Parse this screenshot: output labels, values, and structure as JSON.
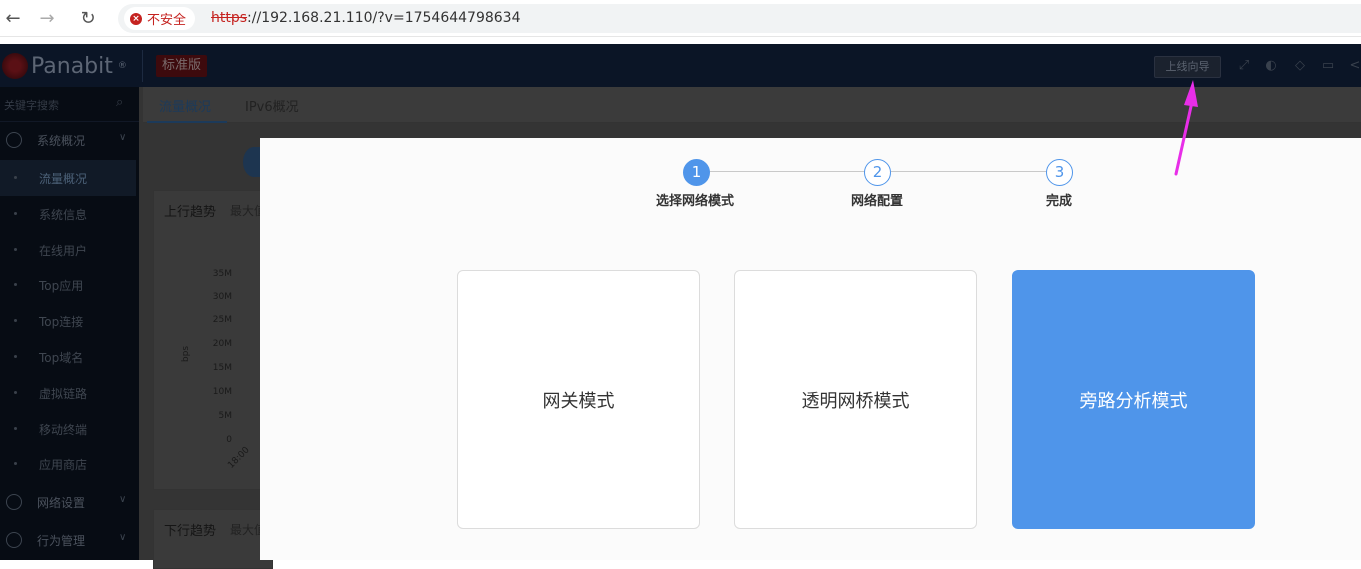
{
  "browser": {
    "back_icon": "arrow-left-icon",
    "forward_icon": "arrow-right-icon",
    "reload_icon": "reload-icon",
    "security_label": "不安全",
    "url_protocol": "https",
    "url_rest": "://192.168.21.110/?v=1754644798634"
  },
  "header": {
    "logo_text": "Panabit",
    "logo_mark": "®",
    "edition_badge": "标准版",
    "wizard_button": "上线向导",
    "icons": [
      "fullscreen-icon",
      "gamepad-icon",
      "bell-icon",
      "book-icon",
      "share-icon"
    ]
  },
  "sidebar": {
    "search_placeholder": "关键字搜索",
    "groups": [
      {
        "label": "系统概况",
        "icon": "dashboard-icon"
      },
      {
        "label": "网络设置",
        "icon": "network-icon"
      },
      {
        "label": "行为管理",
        "icon": "behavior-icon"
      }
    ],
    "items": [
      {
        "label": "流量概况",
        "active": true
      },
      {
        "label": "系统信息"
      },
      {
        "label": "在线用户"
      },
      {
        "label": "Top应用"
      },
      {
        "label": "Top连接"
      },
      {
        "label": "Top域名"
      },
      {
        "label": "虚拟链路"
      },
      {
        "label": "移动终端"
      },
      {
        "label": "应用商店"
      }
    ]
  },
  "main": {
    "tabs": [
      {
        "label": "流量概况",
        "active": true
      },
      {
        "label": "IPv6概况"
      }
    ],
    "upstream": {
      "title": "上行趋势",
      "subtitle": "最大值",
      "y_unit": "bps",
      "y_ticks": [
        "35M",
        "30M",
        "25M",
        "20M",
        "15M",
        "10M",
        "5M",
        "0"
      ],
      "x_tick": "18:00"
    },
    "downstream": {
      "title": "下行趋势",
      "subtitle": "最大值"
    }
  },
  "wizard": {
    "steps": [
      {
        "number": "1",
        "label": "选择网络模式",
        "state": "current"
      },
      {
        "number": "2",
        "label": "网络配置",
        "state": "pending"
      },
      {
        "number": "3",
        "label": "完成",
        "state": "pending"
      }
    ],
    "modes": [
      {
        "label": "网关模式",
        "selected": false
      },
      {
        "label": "透明网桥模式",
        "selected": false
      },
      {
        "label": "旁路分析模式",
        "selected": true
      }
    ],
    "accent_color": "#4f95ea"
  },
  "annotation": {
    "arrow_color": "#e82ee8"
  }
}
